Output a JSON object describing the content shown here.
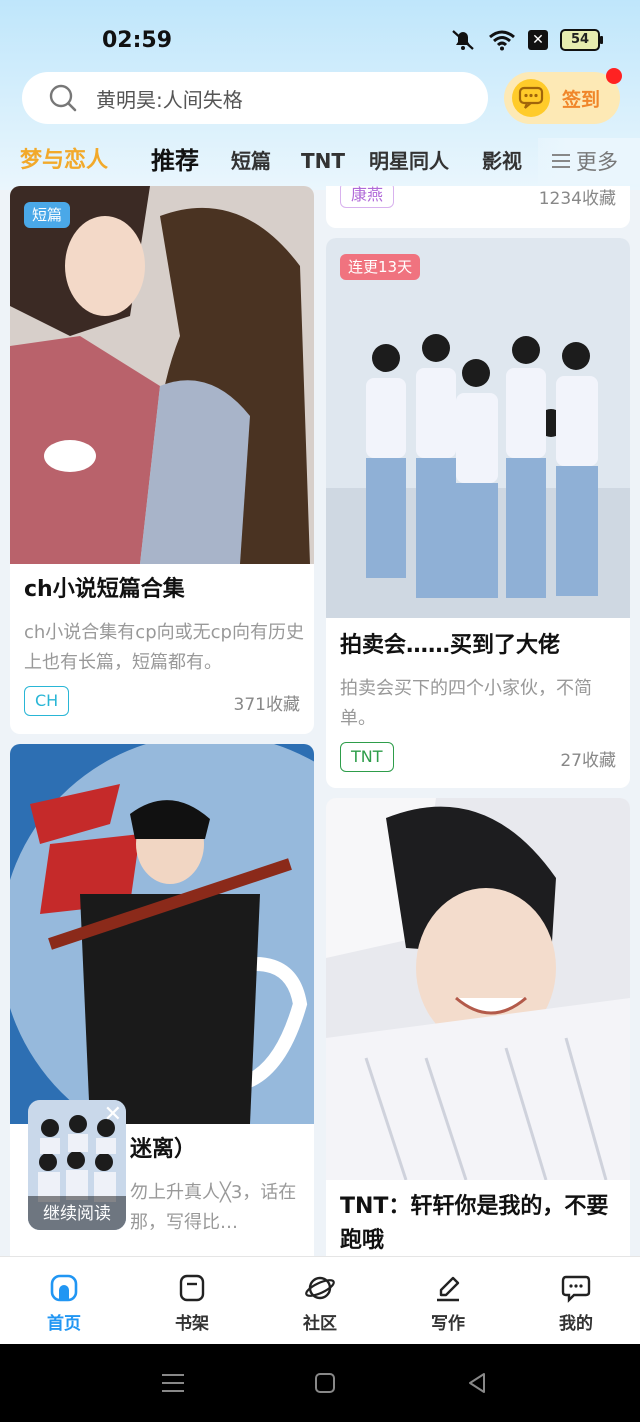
{
  "status_bar": {
    "time": "02:59",
    "battery": "54",
    "x_badge": "✕"
  },
  "search": {
    "placeholder": "黄明昊:人间失格"
  },
  "signin": {
    "label": "签到"
  },
  "tabs": [
    {
      "label": "梦与恋人",
      "style": "brand"
    },
    {
      "label": "推荐",
      "style": "active"
    },
    {
      "label": "短篇"
    },
    {
      "label": "TNT"
    },
    {
      "label": "明星同人"
    },
    {
      "label": "影视"
    }
  ],
  "more_label": "更多",
  "cards": {
    "c1": {
      "badge": "短篇",
      "title": "ch小说短篇合集",
      "desc": "ch小说合集有cp向或无cp向有历史上也有长篇，短篇都有。",
      "tag": "CH",
      "count": "371收藏"
    },
    "c2": {
      "title": "迷离）",
      "desc": "勿上升真人╳3，话在那，写得比…"
    },
    "prev": {
      "tag": "康燕",
      "count": "1234收藏"
    },
    "c3": {
      "badge": "连更13天",
      "title": "拍卖会……买到了大佬",
      "desc": "拍卖会买下的四个小家伙，不简单。",
      "tag": "TNT",
      "count": "27收藏"
    },
    "c4": {
      "title": "TNT：轩轩你是我的，不要跑哦"
    }
  },
  "continue_reading": {
    "label": "继续阅读",
    "close": "✕"
  },
  "bottom_nav": [
    {
      "label": "首页",
      "icon": "home-icon",
      "active": true
    },
    {
      "label": "书架",
      "icon": "bookshelf-icon"
    },
    {
      "label": "社区",
      "icon": "planet-icon"
    },
    {
      "label": "写作",
      "icon": "pen-icon"
    },
    {
      "label": "我的",
      "icon": "chat-bubble-icon"
    }
  ],
  "colors": {
    "accent": "#2196f3",
    "brand_tab": "#f2a92a",
    "signin_text": "#f0862a",
    "tag_ch": "#29b6d6",
    "tag_tnt": "#2e9d4a",
    "tag_kangyan": "#b06ad8"
  }
}
